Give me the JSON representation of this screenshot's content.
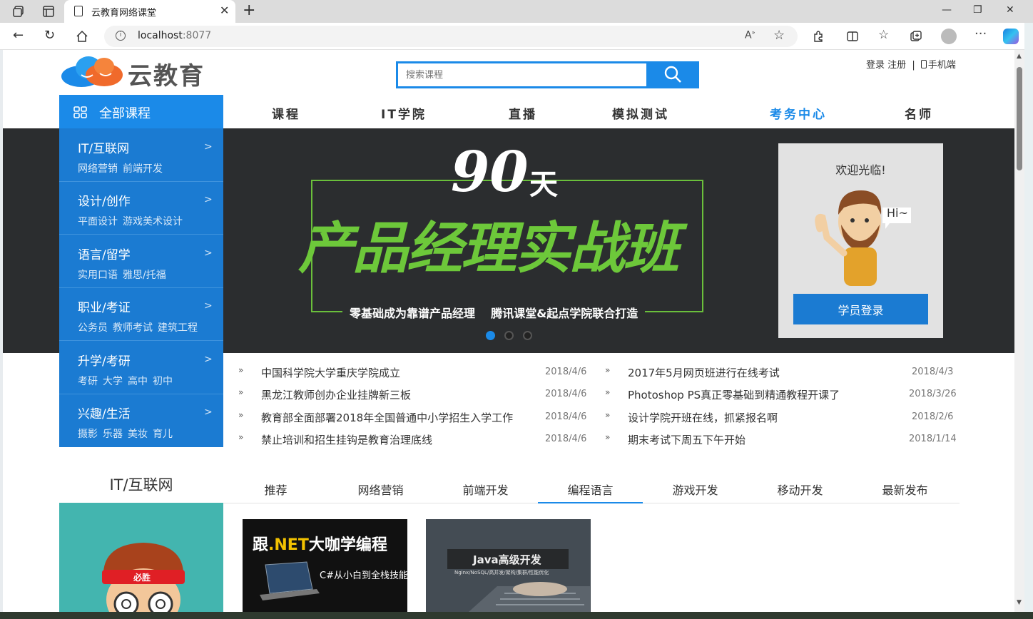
{
  "browser": {
    "tab_title": "云教育网络课堂",
    "url_host": "localhost",
    "url_port": ":8077"
  },
  "site": {
    "logo_text": "云教育",
    "search_placeholder": "搜索课程",
    "login": "登录",
    "register": "注册",
    "mobile": "手机端",
    "nav": [
      "课程",
      "IT学院",
      "直播",
      "模拟测试",
      "考务中心",
      "名师"
    ],
    "active_nav_color": "#1b8ae8"
  },
  "sidebar": {
    "header": "全部课程",
    "categories": [
      {
        "title": "IT/互联网",
        "subs": [
          "网络营销",
          "前端开发"
        ]
      },
      {
        "title": "设计/创作",
        "subs": [
          "平面设计",
          "游戏美术设计"
        ]
      },
      {
        "title": "语言/留学",
        "subs": [
          "实用口语",
          "雅思/托福"
        ]
      },
      {
        "title": "职业/考证",
        "subs": [
          "公务员",
          "教师考试",
          "建筑工程"
        ]
      },
      {
        "title": "升学/考研",
        "subs": [
          "考研",
          "大学",
          "高中",
          "初中"
        ]
      },
      {
        "title": "兴趣/生活",
        "subs": [
          "摄影",
          "乐器",
          "美妆",
          "育儿"
        ]
      }
    ]
  },
  "banner": {
    "days": "90",
    "days_unit": "天",
    "title": "产品经理实战班",
    "subtitle": "零基础成为靠谱产品经理    腾讯课堂&起点学院联合打造",
    "active_dot": 0
  },
  "welcome": {
    "greeting": "欢迎光临!",
    "hi": "Hi~",
    "login_button": "学员登录"
  },
  "news": {
    "left": [
      {
        "title": "中国科学院大学重庆学院成立",
        "date": "2018/4/6"
      },
      {
        "title": "黑龙江教师创办企业挂牌新三板",
        "date": "2018/4/6"
      },
      {
        "title": "教育部全面部署2018年全国普通中小学招生入学工作",
        "date": "2018/4/6"
      },
      {
        "title": "禁止培训和招生挂钩是教育治理底线",
        "date": "2018/4/6"
      }
    ],
    "right": [
      {
        "title": "2017年5月网页班进行在线考试",
        "date": "2018/4/3"
      },
      {
        "title": "Photoshop PS真正零基础到精通教程开课了",
        "date": "2018/3/26"
      },
      {
        "title": "设计学院开班在线，抓紧报名啊",
        "date": "2018/2/6"
      },
      {
        "title": "期末考试下周五下午开始",
        "date": "2018/1/14"
      }
    ]
  },
  "section": {
    "title": "IT/互联网",
    "tabs": [
      "推荐",
      "网络营销",
      "前端开发",
      "编程语言",
      "游戏开发",
      "移动开发",
      "最新发布"
    ],
    "active_tab": 3,
    "promo_badge": "必胜"
  },
  "courses": [
    {
      "headline_a": "跟",
      "headline_b": ".NET",
      "headline_c": "大咖学编程",
      "subtitle": "C#从小白到全栈技能"
    },
    {
      "headline": "Java高级开发",
      "subtitle": "Nginx/NoSQL/高并发/架构/集群/性能优化"
    }
  ]
}
